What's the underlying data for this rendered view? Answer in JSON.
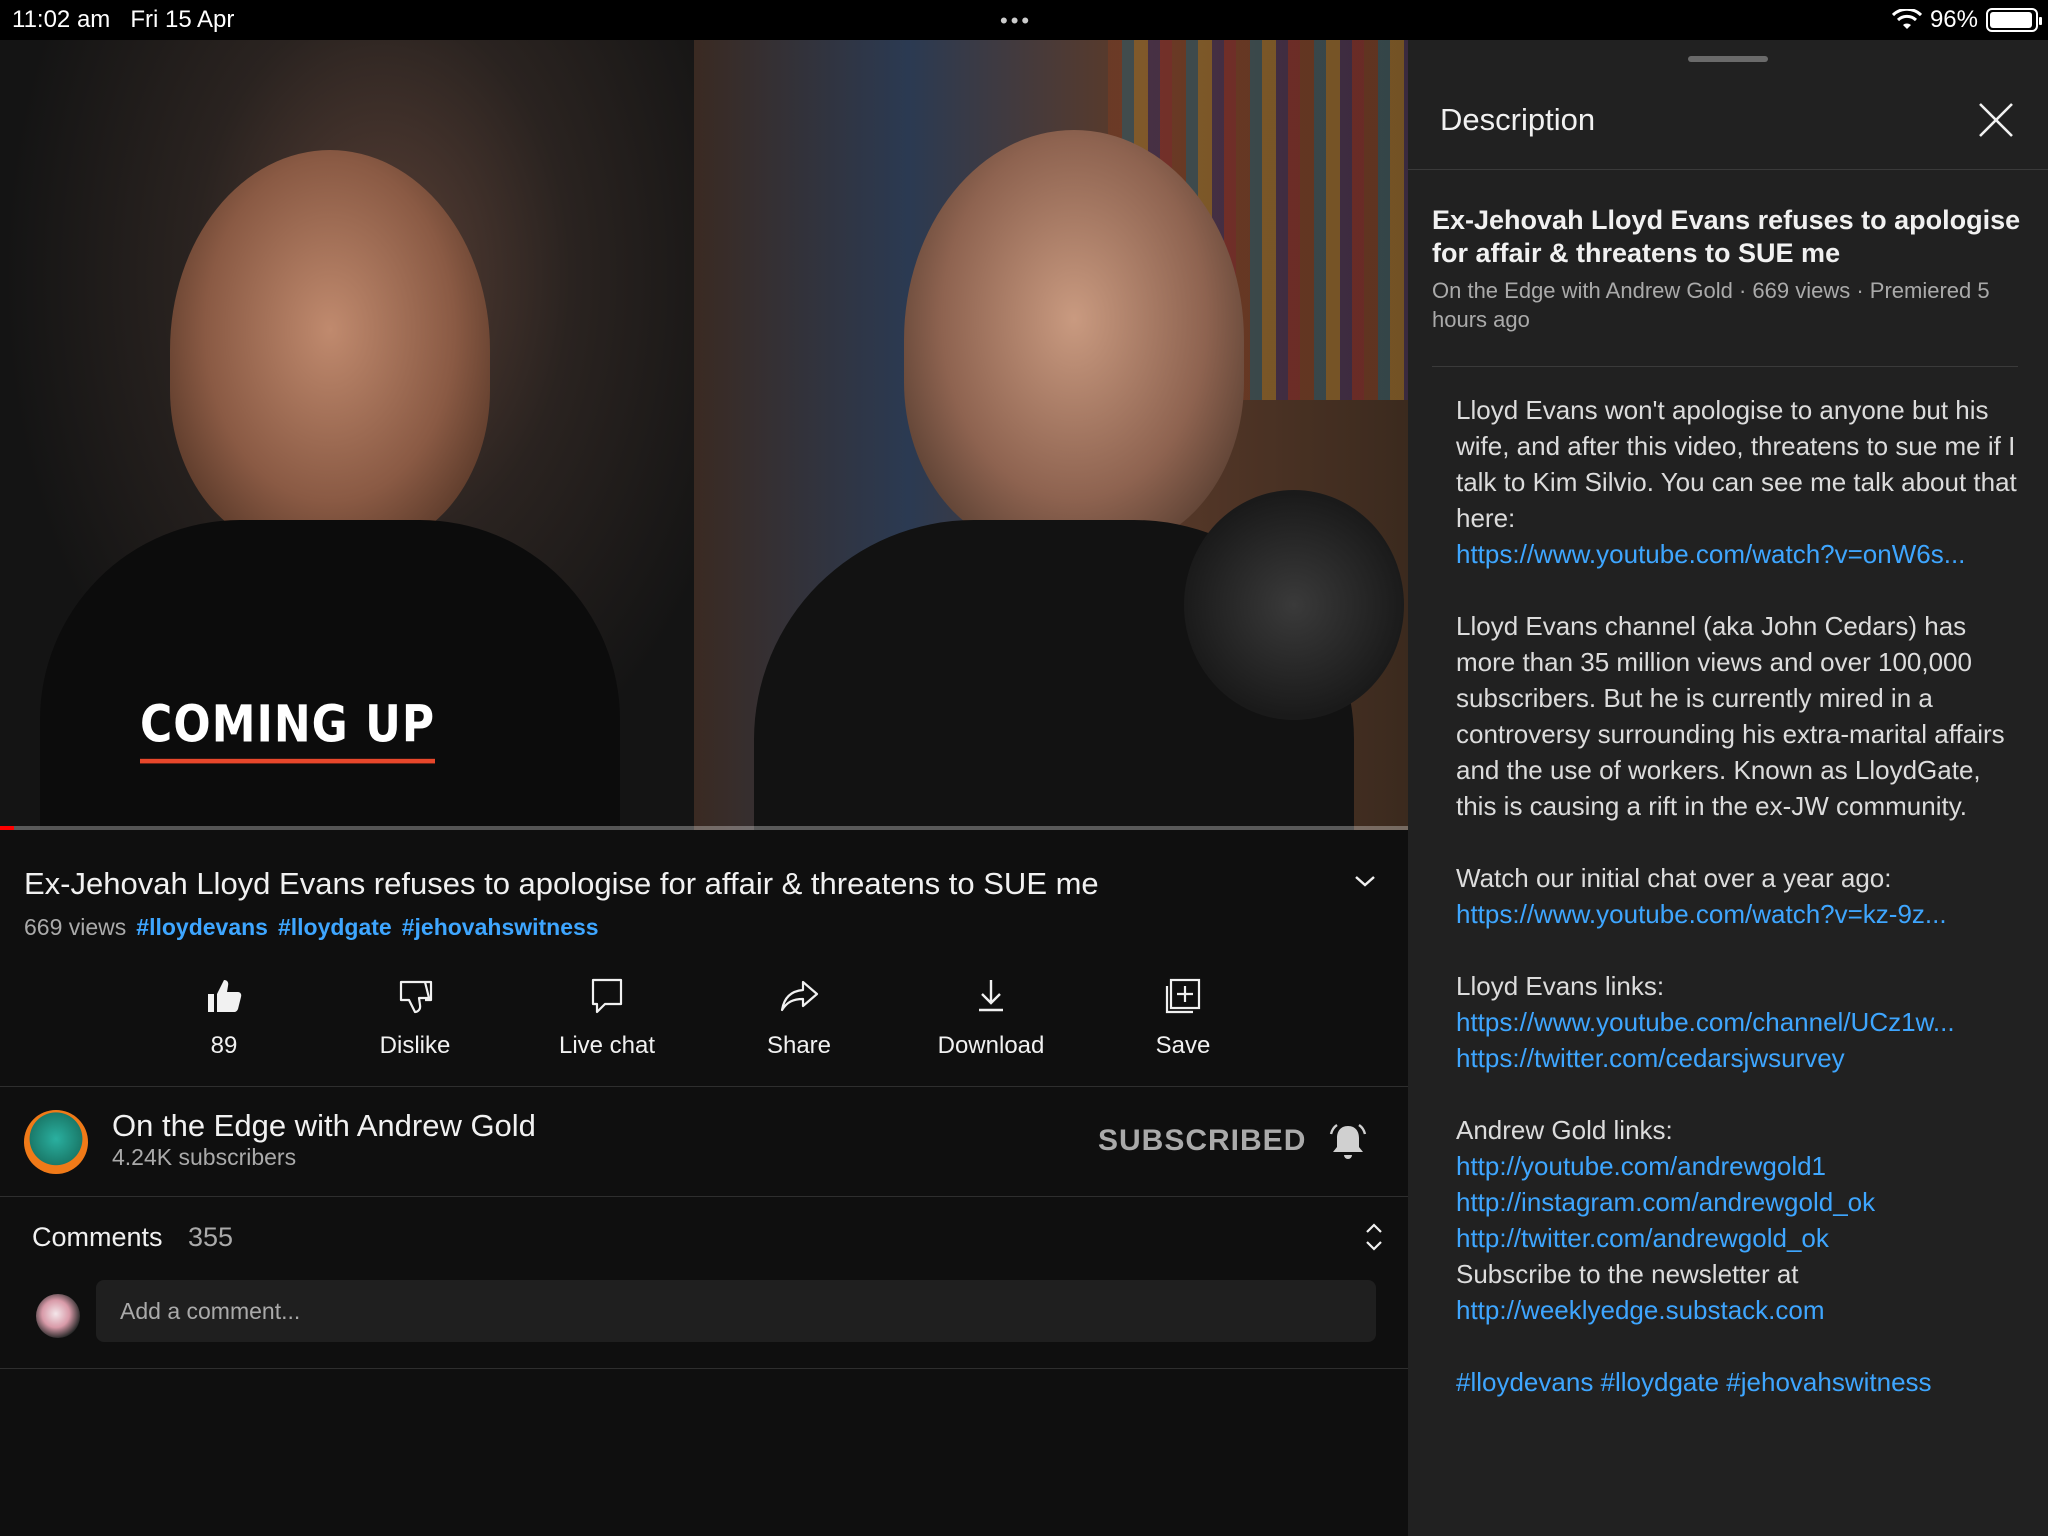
{
  "status_bar": {
    "time": "11:02 am",
    "date": "Fri 15 Apr",
    "dots": "•••",
    "battery": "96%",
    "battery_level": 0.96
  },
  "video": {
    "overlay_text": "COMING UP",
    "progress": 0.01,
    "title": "Ex-Jehovah Lloyd Evans refuses to apologise for affair & threatens to SUE me",
    "views": "669 views",
    "hashtags": [
      "#lloydevans",
      "#lloydgate",
      "#jehovahswitness"
    ]
  },
  "actions": {
    "like": "89",
    "dislike": "Dislike",
    "live_chat": "Live chat",
    "share": "Share",
    "download": "Download",
    "save": "Save"
  },
  "channel": {
    "name": "On the Edge with Andrew Gold",
    "subscribers": "4.24K subscribers",
    "subscribe_state": "SUBSCRIBED"
  },
  "comments": {
    "label": "Comments",
    "count": "355",
    "placeholder": "Add a comment..."
  },
  "description_panel": {
    "header": "Description",
    "title": "Ex-Jehovah Lloyd Evans refuses to apologise for affair & threatens to SUE me",
    "meta": "On the Edge with Andrew Gold · 669 views · Premiered 5 hours ago",
    "para1": "Lloyd Evans won't apologise to anyone but his wife, and after this video, threatens to sue me if I talk to Kim Silvio. You can see me talk about that here:",
    "link1": "https://www.youtube.com/watch?v=onW6s...",
    "para2": "Lloyd Evans channel (aka John Cedars) has more than 35 million views and over 100,000 subscribers. But he is currently mired in a controversy surrounding his extra-marital affairs and the use of workers. Known as LloydGate, this is causing a rift in the ex-JW community.",
    "para3": "Watch our initial chat over a year ago:",
    "link2": "https://www.youtube.com/watch?v=kz-9z...",
    "lloyd_links_label": "Lloyd Evans links:",
    "lloyd_link1": "https://www.youtube.com/channel/UCz1w...",
    "lloyd_link2": "https://twitter.com/cedarsjwsurvey",
    "andrew_links_label": "Andrew Gold links:",
    "andrew_link1": "http://youtube.com/andrewgold1",
    "andrew_link2": "http://instagram.com/andrewgold_ok",
    "andrew_link3": "http://twitter.com/andrewgold_ok",
    "newsletter_text": "Subscribe to the newsletter at",
    "newsletter_link": "http://weeklyedge.substack.com",
    "footer_tags": "#lloydevans #lloydgate #jehovahswitness"
  },
  "colors": {
    "link": "#3ea6ff",
    "background": "#0f0f0f",
    "panel": "#212121",
    "accent_red": "#ff0000",
    "overlay_underline": "#e8472b"
  }
}
